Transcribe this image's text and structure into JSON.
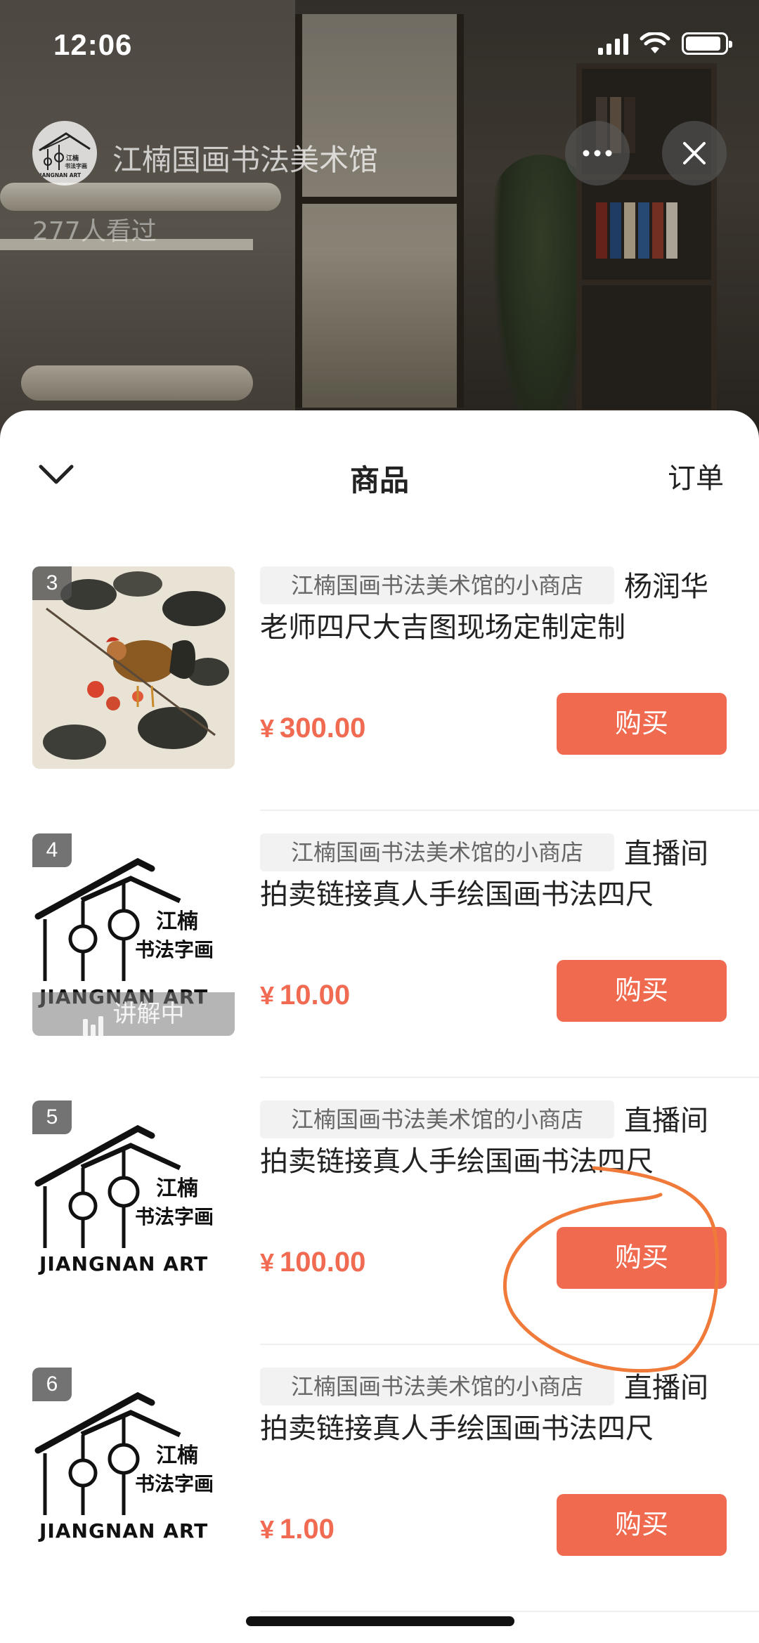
{
  "status_bar": {
    "time": "12:06",
    "battery_level": 0.9
  },
  "live": {
    "channel_name": "江楠国画书法美术馆",
    "viewer_count": "277人看过",
    "avatar_logo_text": [
      "江楠",
      "书法字画",
      "JIANGNAN ART"
    ]
  },
  "sheet": {
    "title": "商品",
    "orders_tab": "订单"
  },
  "products": [
    {
      "index": "3",
      "shop_tag": "江楠国画书法美术馆的小商店",
      "title": "杨润华老师四尺大吉图现场定制定制",
      "price_symbol": "¥",
      "price": "300.00",
      "buy_label": "购买",
      "image": "rooster-painting"
    },
    {
      "index": "4",
      "shop_tag": "江楠国画书法美术馆的小商店",
      "title": "直播间拍卖链接真人手绘国画书法四尺",
      "price_symbol": "¥",
      "price": "10.00",
      "buy_label": "购买",
      "image": "jiangnan-logo",
      "explaining_label": "讲解中"
    },
    {
      "index": "5",
      "shop_tag": "江楠国画书法美术馆的小商店",
      "title": "直播间拍卖链接真人手绘国画书法四尺",
      "price_symbol": "¥",
      "price": "100.00",
      "buy_label": "购买",
      "image": "jiangnan-logo"
    },
    {
      "index": "6",
      "shop_tag": "江楠国画书法美术馆的小商店",
      "title": "直播间拍卖链接真人手绘国画书法四尺",
      "price_symbol": "¥",
      "price": "1.00",
      "buy_label": "购买",
      "image": "jiangnan-logo"
    }
  ],
  "logo": {
    "cn_line1": "江楠",
    "cn_line2": "书法字画",
    "en": "JIANGNAN ART"
  },
  "colors": {
    "accent": "#ef6a4e",
    "price": "#f06b52",
    "annotation": "#f07a3a"
  },
  "icons": [
    "signal-icon",
    "wifi-icon",
    "battery-icon",
    "more-icon",
    "close-icon",
    "chevron-down-icon",
    "equalizer-icon"
  ]
}
